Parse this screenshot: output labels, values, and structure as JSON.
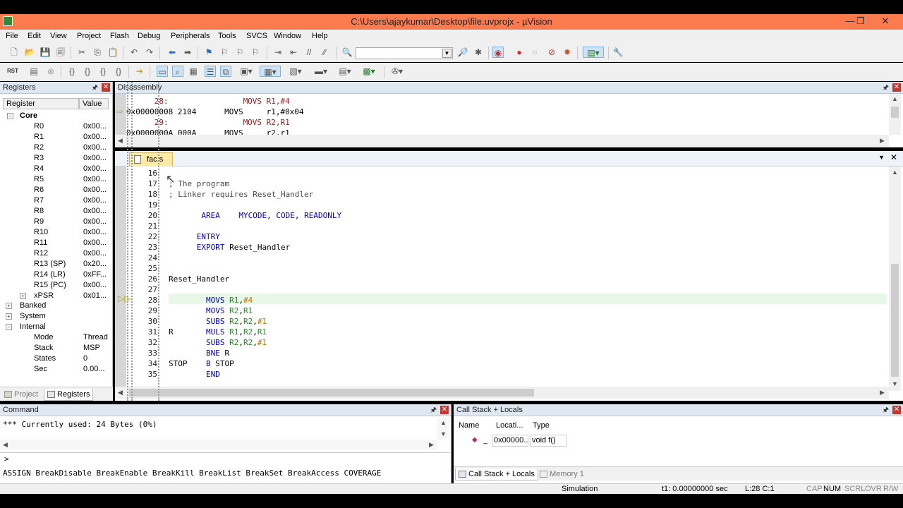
{
  "window": {
    "title": "C:\\Users\\ajaykumar\\Desktop\\file.uvprojx - µVision",
    "minimize": "—",
    "restore": "❐",
    "close": "✕"
  },
  "menu": [
    "File",
    "Edit",
    "View",
    "Project",
    "Flash",
    "Debug",
    "Peripherals",
    "Tools",
    "SVCS",
    "Window",
    "Help"
  ],
  "registers": {
    "title": "Registers",
    "col_register": "Register",
    "col_value": "Value",
    "core_label": "Core",
    "rows": [
      {
        "name": "R0",
        "value": "0x00..."
      },
      {
        "name": "R1",
        "value": "0x00..."
      },
      {
        "name": "R2",
        "value": "0x00..."
      },
      {
        "name": "R3",
        "value": "0x00..."
      },
      {
        "name": "R4",
        "value": "0x00..."
      },
      {
        "name": "R5",
        "value": "0x00..."
      },
      {
        "name": "R6",
        "value": "0x00..."
      },
      {
        "name": "R7",
        "value": "0x00..."
      },
      {
        "name": "R8",
        "value": "0x00..."
      },
      {
        "name": "R9",
        "value": "0x00..."
      },
      {
        "name": "R10",
        "value": "0x00..."
      },
      {
        "name": "R11",
        "value": "0x00..."
      },
      {
        "name": "R12",
        "value": "0x00..."
      },
      {
        "name": "R13 (SP)",
        "value": "0x20..."
      },
      {
        "name": "R14 (LR)",
        "value": "0xFF..."
      },
      {
        "name": "R15 (PC)",
        "value": "0x00..."
      },
      {
        "name": "xPSR",
        "value": "0x01..."
      }
    ],
    "banked": "Banked",
    "system": "System",
    "internal": "Internal",
    "internal_rows": [
      {
        "name": "Mode",
        "value": "Thread"
      },
      {
        "name": "Stack",
        "value": "MSP"
      },
      {
        "name": "States",
        "value": "0"
      },
      {
        "name": "Sec",
        "value": "0.00..."
      }
    ],
    "tab_project": "Project",
    "tab_registers": "Registers"
  },
  "disassembly": {
    "title": "Disassembly",
    "lines": [
      "      28:                MOVS R1,#4",
      "0x00000008 2104      MOVS     r1,#0x04",
      "      29:                MOVS R2,R1",
      "0x0000000A 000A      MOVS     r2,r1"
    ]
  },
  "editor": {
    "tab": "fac.s",
    "lines": [
      {
        "n": "16",
        "text": ""
      },
      {
        "n": "17",
        "text": "; The program"
      },
      {
        "n": "18",
        "text": "; Linker requires Reset_Handler"
      },
      {
        "n": "19",
        "text": ""
      },
      {
        "n": "20",
        "text": "       AREA    MYCODE, CODE, READONLY"
      },
      {
        "n": "21",
        "text": ""
      },
      {
        "n": "22",
        "text": "      ENTRY"
      },
      {
        "n": "23",
        "text": "      EXPORT Reset_Handler"
      },
      {
        "n": "24",
        "text": ""
      },
      {
        "n": "25",
        "text": ""
      },
      {
        "n": "26",
        "text": "Reset_Handler"
      },
      {
        "n": "27",
        "text": ""
      },
      {
        "n": "28",
        "text": "        MOVS R1,#4"
      },
      {
        "n": "29",
        "text": "        MOVS R2,R1"
      },
      {
        "n": "30",
        "text": "        SUBS R2,R2,#1"
      },
      {
        "n": "31",
        "text": "R       MULS R1,R2,R1"
      },
      {
        "n": "32",
        "text": "        SUBS R2,R2,#1"
      },
      {
        "n": "33",
        "text": "        BNE R"
      },
      {
        "n": "34",
        "text": "STOP    B STOP"
      },
      {
        "n": "35",
        "text": "        END"
      }
    ]
  },
  "command": {
    "title": "Command",
    "output": "*** Currently used: 24 Bytes (0%)",
    "prompt": ">",
    "hints": "ASSIGN BreakDisable BreakEnable BreakKill BreakList BreakSet BreakAccess COVERAGE"
  },
  "callstack": {
    "title": "Call Stack + Locals",
    "col_name": "Name",
    "col_location": "Locati...",
    "col_type": "Type",
    "row": {
      "name": "_",
      "location": "0x00000...",
      "type": "void f()"
    },
    "tab_callstack": "Call Stack + Locals",
    "tab_memory": "Memory 1"
  },
  "status": {
    "mode": "Simulation",
    "time": "t1: 0.00000000 sec",
    "position": "L:28 C:1",
    "cap": "CAP",
    "num": "NUM",
    "scrl": "SCRL",
    "ovr": "OVR",
    "rw": "R/W"
  }
}
